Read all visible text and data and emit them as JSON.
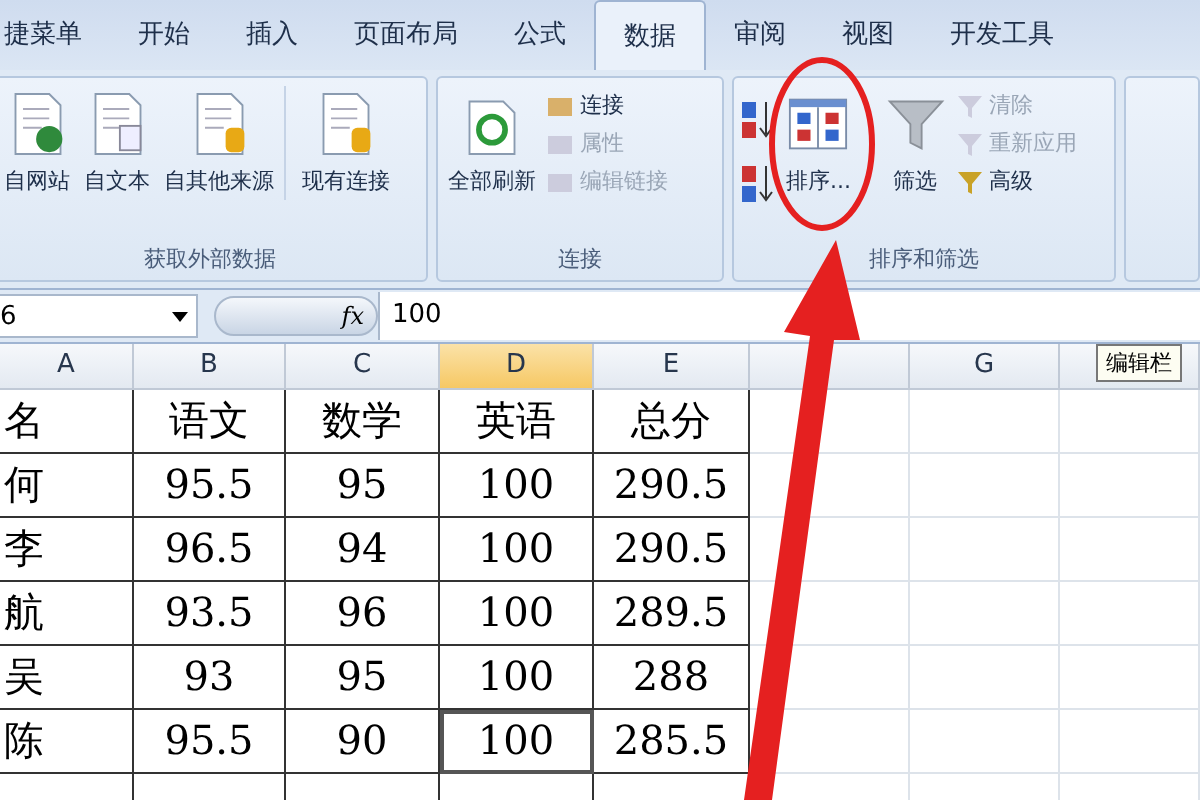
{
  "tabs": [
    {
      "label": "捷菜单",
      "selected": false
    },
    {
      "label": "开始",
      "selected": false
    },
    {
      "label": "插入",
      "selected": false
    },
    {
      "label": "页面布局",
      "selected": false
    },
    {
      "label": "公式",
      "selected": false
    },
    {
      "label": "数据",
      "selected": true
    },
    {
      "label": "审阅",
      "selected": false
    },
    {
      "label": "视图",
      "selected": false
    },
    {
      "label": "开发工具",
      "selected": false
    }
  ],
  "ribbon": {
    "groups": [
      {
        "label": "获取外部数据",
        "items": [
          {
            "label": "自网站",
            "disabled": false
          },
          {
            "label": "自文本",
            "disabled": false
          },
          {
            "label": "自其他来源",
            "disabled": false
          },
          {
            "label": "现有连接",
            "disabled": false
          }
        ]
      },
      {
        "label": "连接",
        "items": [
          {
            "label": "全部刷新",
            "disabled": false
          },
          {
            "label": "连接",
            "disabled": false
          },
          {
            "label": "属性",
            "disabled": true
          },
          {
            "label": "编辑链接",
            "disabled": true
          }
        ]
      },
      {
        "label": "排序和筛选",
        "items": [
          {
            "label": "排序...",
            "disabled": false
          },
          {
            "label": "筛选",
            "disabled": false
          },
          {
            "label": "清除",
            "disabled": true
          },
          {
            "label": "重新应用",
            "disabled": true
          },
          {
            "label": "高级",
            "disabled": false
          }
        ]
      }
    ]
  },
  "formula_bar": {
    "name_box": "6",
    "fx": "fx",
    "value": "100"
  },
  "tooltip": "编辑栏",
  "table": {
    "columns": [
      {
        "label": "A",
        "selected": false
      },
      {
        "label": "B",
        "selected": false
      },
      {
        "label": "C",
        "selected": false
      },
      {
        "label": "D",
        "selected": true
      },
      {
        "label": "E",
        "selected": false
      },
      {
        "selected": false
      },
      {
        "label": "G",
        "selected": false
      },
      {
        "selected": false
      }
    ],
    "rows": [
      {
        "cells": [
          {
            "text": "名",
            "selected": false
          },
          {
            "text": "语文",
            "selected": false
          },
          {
            "text": "数学",
            "selected": false
          },
          {
            "text": "英语",
            "selected": false
          },
          {
            "text": "总分",
            "selected": false
          }
        ]
      },
      {
        "cells": [
          {
            "text": "何",
            "selected": false
          },
          {
            "text": "95.5",
            "selected": false
          },
          {
            "text": "95",
            "selected": false
          },
          {
            "text": "100",
            "selected": false
          },
          {
            "text": "290.5",
            "selected": false
          }
        ]
      },
      {
        "cells": [
          {
            "text": "李",
            "selected": false
          },
          {
            "text": "96.5",
            "selected": false
          },
          {
            "text": "94",
            "selected": false
          },
          {
            "text": "100",
            "selected": false
          },
          {
            "text": "290.5",
            "selected": false
          }
        ]
      },
      {
        "cells": [
          {
            "text": "航",
            "selected": false
          },
          {
            "text": "93.5",
            "selected": false
          },
          {
            "text": "96",
            "selected": false
          },
          {
            "text": "100",
            "selected": false
          },
          {
            "text": "289.5",
            "selected": false
          }
        ]
      },
      {
        "cells": [
          {
            "text": "吴",
            "selected": false
          },
          {
            "text": "93",
            "selected": false
          },
          {
            "text": "95",
            "selected": false
          },
          {
            "text": "100",
            "selected": false
          },
          {
            "text": "288",
            "selected": false
          }
        ]
      },
      {
        "cells": [
          {
            "text": "陈",
            "selected": false
          },
          {
            "text": "95.5",
            "selected": false
          },
          {
            "text": "90",
            "selected": false
          },
          {
            "text": "100",
            "selected": true
          },
          {
            "text": "285.5",
            "selected": false
          }
        ]
      }
    ]
  }
}
